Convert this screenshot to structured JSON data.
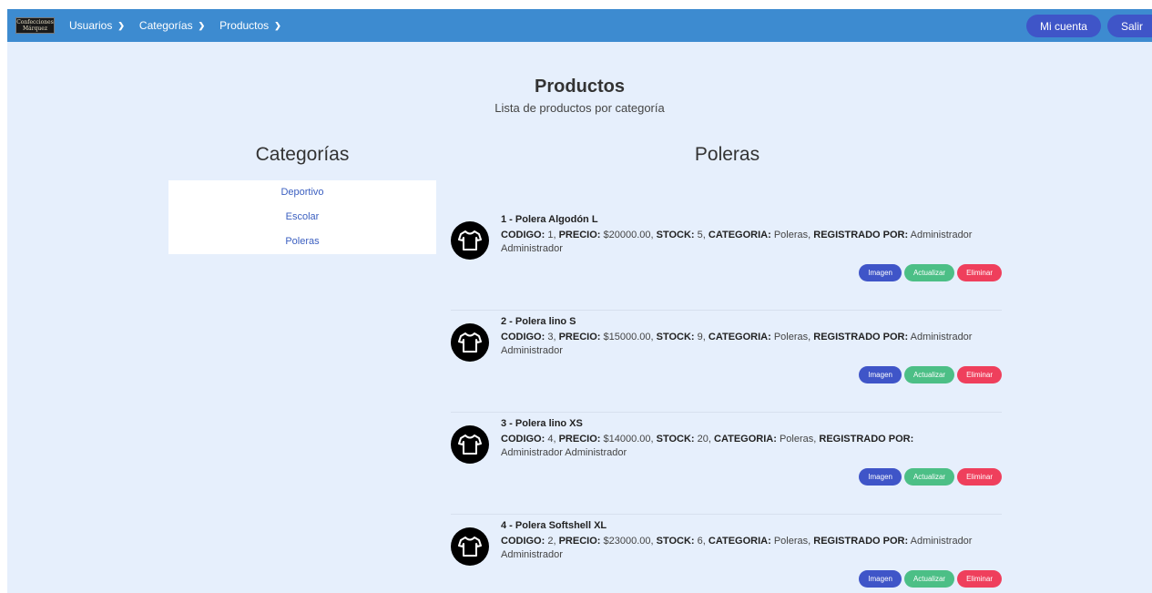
{
  "navbar": {
    "logo_text": "Confecciones Márquez",
    "menus": [
      {
        "label": "Usuarios"
      },
      {
        "label": "Categorías"
      },
      {
        "label": "Productos"
      }
    ],
    "account_label": "Mi cuenta",
    "logout_label": "Salir"
  },
  "page": {
    "title": "Productos",
    "subtitle": "Lista de productos por categoría"
  },
  "categories": {
    "heading": "Categorías",
    "items": [
      "Deportivo",
      "Escolar",
      "Poleras"
    ]
  },
  "section": {
    "heading": "Poleras"
  },
  "labels": {
    "codigo": "CODIGO:",
    "precio": "PRECIO:",
    "stock": "STOCK:",
    "categoria": "CATEGORIA:",
    "registrado": "REGISTRADO POR:",
    "btn_imagen": "Imagen",
    "btn_actualizar": "Actualizar",
    "btn_eliminar": "Eliminar"
  },
  "products": [
    {
      "title": "1 - Polera Algodón L",
      "codigo": "1",
      "precio": "$20000.00",
      "stock": "5",
      "categoria": "Poleras",
      "registrado": "Administrador Administrador"
    },
    {
      "title": "2 - Polera lino S",
      "codigo": "3",
      "precio": "$15000.00",
      "stock": "9",
      "categoria": "Poleras",
      "registrado": "Administrador Administrador"
    },
    {
      "title": "3 - Polera lino XS",
      "codigo": "4",
      "precio": "$14000.00",
      "stock": "20",
      "categoria": "Poleras",
      "registrado": "Administrador Administrador"
    },
    {
      "title": "4 - Polera Softshell XL",
      "codigo": "2",
      "precio": "$23000.00",
      "stock": "6",
      "categoria": "Poleras",
      "registrado": "Administrador Administrador"
    }
  ],
  "icons": {
    "product": "tshirt-icon",
    "dropdown": "chevron-down-icon"
  },
  "colors": {
    "navbar": "#3d8bd0",
    "background": "#e6effc",
    "primary_button": "#3f55c8",
    "update_button": "#4cbf86",
    "delete_button": "#ef3f5c",
    "link": "#3b5fc0"
  }
}
